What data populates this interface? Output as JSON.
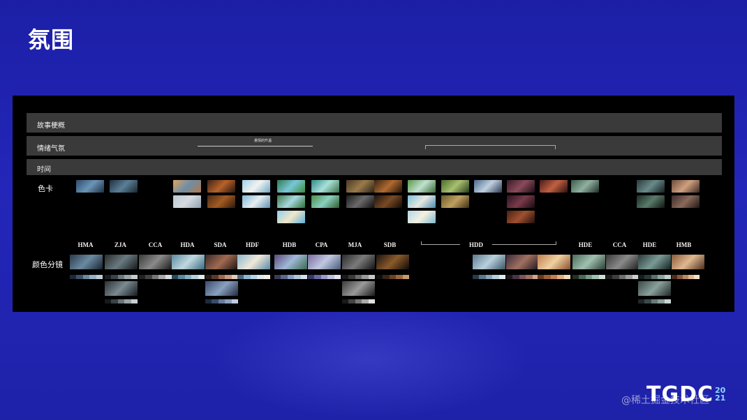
{
  "slide": {
    "title": "氛围"
  },
  "rows": {
    "story": "故事梗概",
    "mood": "情绪气氛",
    "time": "时间",
    "swatch": "色卡",
    "grading": "颜色分镜"
  },
  "mood_row": {
    "ascent_label": "悬情的升温"
  },
  "codes": [
    "HMA",
    "ZJA",
    "CCA",
    "HDA",
    "SDA",
    "HDF",
    "HDB",
    "CPA",
    "MJA",
    "SDB",
    "HDD",
    "HDE",
    "CCA",
    "HDE",
    "HMB"
  ],
  "logo": {
    "main": "TGDC",
    "year_top": "20",
    "year_bottom": "21"
  },
  "watermark": "@稀土掘金技术社区",
  "colors": {
    "background": "#2326b8",
    "board": "#000000",
    "band": "#3a3a3a"
  }
}
